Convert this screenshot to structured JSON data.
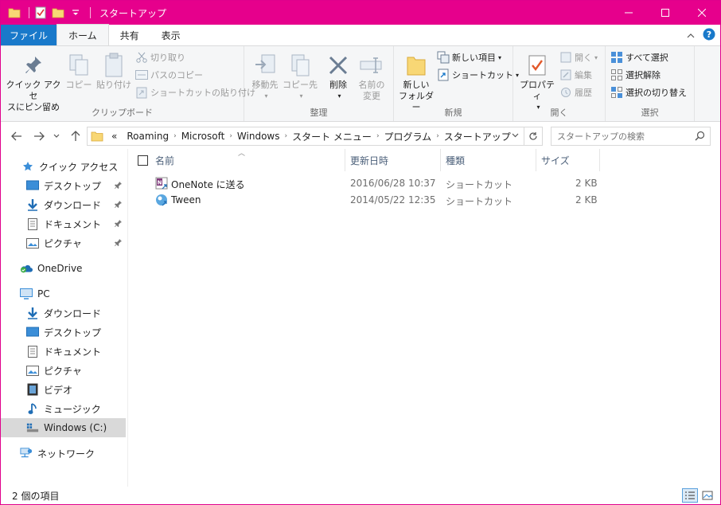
{
  "window": {
    "title": "スタートアップ",
    "accent": "#e6008c",
    "file_tab_color": "#1979ca"
  },
  "tabs": [
    {
      "label": "ファイル"
    },
    {
      "label": "ホーム"
    },
    {
      "label": "共有"
    },
    {
      "label": "表示"
    }
  ],
  "ribbon": {
    "clipboard": {
      "label": "クリップボード",
      "pin_quick_access": "クイック アクセ\nスにピン留め",
      "copy": "コピー",
      "paste": "貼り付け",
      "cut": "切り取り",
      "copy_path": "パスのコピー",
      "paste_shortcut": "ショートカットの貼り付け"
    },
    "organize": {
      "label": "整理",
      "move_to": "移動先",
      "copy_to": "コピー先",
      "delete": "削除",
      "rename": "名前の\n変更"
    },
    "new": {
      "label": "新規",
      "new_folder": "新しい\nフォルダー",
      "new_item": "新しい項目",
      "shortcut": "ショートカット"
    },
    "open": {
      "label": "開く",
      "properties": "プロパティ",
      "open": "開く",
      "edit": "編集",
      "history": "履歴"
    },
    "select": {
      "label": "選択",
      "select_all": "すべて選択",
      "select_none": "選択解除",
      "invert": "選択の切り替え"
    }
  },
  "address": {
    "overflow": "«",
    "crumbs": [
      "Roaming",
      "Microsoft",
      "Windows",
      "スタート メニュー",
      "プログラム",
      "スタートアップ"
    ]
  },
  "search": {
    "placeholder": "スタートアップの検索"
  },
  "sidebar": {
    "quick_access": "クイック アクセス",
    "quick_items": [
      "デスクトップ",
      "ダウンロード",
      "ドキュメント",
      "ピクチャ"
    ],
    "onedrive": "OneDrive",
    "pc": "PC",
    "pc_items": [
      "ダウンロード",
      "デスクトップ",
      "ドキュメント",
      "ピクチャ",
      "ビデオ",
      "ミュージック",
      "Windows (C:)"
    ],
    "network": "ネットワーク"
  },
  "columns": {
    "name": "名前",
    "modified": "更新日時",
    "type": "種類",
    "size": "サイズ"
  },
  "files": [
    {
      "name": "OneNote に送る",
      "modified": "2016/06/28 10:37",
      "type": "ショートカット",
      "size": "2 KB",
      "icon": "onenote-icon"
    },
    {
      "name": "Tween",
      "modified": "2014/05/22 12:35",
      "type": "ショートカット",
      "size": "2 KB",
      "icon": "tween-icon"
    }
  ],
  "status": {
    "count": "2 個の項目"
  }
}
